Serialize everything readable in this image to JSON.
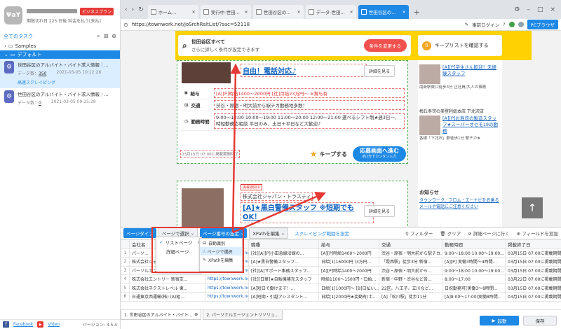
{
  "brand": {
    "logo": "ΨaY",
    "plan_badge": "ビジネスプラン",
    "expire": "期限切れ日 225 日後 料金を払う[支払]"
  },
  "tasks": {
    "header": "全てのタスク",
    "samples": "Samples",
    "default": "デフォルト",
    "items": [
      {
        "title": "世田谷区のアルバイト・バイト求人情報｜...",
        "data_label": "データ数：",
        "count": "350",
        "date": "2021-03-05 10:12:28",
        "cloud": "高速スクレイピング"
      },
      {
        "title": "世田谷区のアルバイト・バイト求人情報｜...",
        "data_label": "データ数：",
        "count": "0",
        "date": "2021-03-05 09:15:28",
        "cloud": ""
      }
    ]
  },
  "left_footer": {
    "facebook": "Facebook",
    "video": "Video",
    "version": "バージョン: 3.5.4"
  },
  "browser": {
    "tabs": [
      "ホーム...",
      "実行中-世田...",
      "世田谷区の...",
      "データ-世田...",
      "世田谷区の..."
    ],
    "url": "https://townwork.net/joSrchRsltList/?sac=52118",
    "login": "事前ログイン",
    "pc_browser": "PCブラウザ"
  },
  "page": {
    "search_title": "世田谷区すべて",
    "search_sub": "さらに詳しく条件が設定できます",
    "change_btn": "条件を変更する",
    "keep_count": "0",
    "keep_list": "キープリストを確認する",
    "job1_title": "自由！電話対応♪",
    "detail_btn": "詳細を見る",
    "salary_k": "給与",
    "salary_v": "[A][P]時給1400～2000円 [社]月給23万円～ ※賞与有",
    "transport_k": "交通",
    "transport_v": "渋谷・原宿・明大前から駅チカ勤務地多数！",
    "hours_k": "勤務時間",
    "hours_v": "9:00～18:00 10:00～19:00 11:00～20:00 12:00～21:00 選べるシフト制★週3日～、時短勤務応相談 平日のみ、土日＋平日など大歓迎♪",
    "date_small": "03月15日 07:00に掲載期間終了",
    "keep_btn": "キープする",
    "apply_btn": "応募画面へ進む",
    "apply_sub": "約1分でカンタン入力",
    "job2_badge": "掲載期間中",
    "job2_company": "株式会社ジャパン・トラスティ",
    "job2_title": "[A]★黒白警備スタッフ ※短期でもOK！",
    "side": [
      {
        "head": "",
        "title": "[A][P]学生さん歓迎！未経験スタッフ",
        "sub": "南新駅東口徒歩3分 正社員/大人の事務"
      },
      {
        "head": "梅丘寿司の美登利総本店 下北沢店",
        "title": "[A][P]お寿司の製造スタッフ★スーパーオセモ19の勤務",
        "sub": "各線「下北沢」駅徒歩1分 駅チカ★"
      }
    ],
    "notice_h": "お知らせ",
    "notice_b": "タウンワーク、フロム・エーナビを名乗るメールや電話にご注意ください"
  },
  "toolbar": {
    "page_type": "ページタイプ",
    "page_select": "ページで選択",
    "page_no": "ページ番号の設定",
    "xpath": "XPathを編集",
    "scrape_range": "スクレイピング範囲を設定",
    "filter": "フィルター",
    "clear": "クリア",
    "detail_page": "詳細ページに行く",
    "add_field": "フィールドを追加"
  },
  "dropdown": [
    "リストページ",
    "詳細ページ"
  ],
  "submenu": [
    "自動識別",
    "ページで選択",
    "XPathを編集"
  ],
  "grid": {
    "columns": [
      "会社名",
      "",
      "職種",
      "給与",
      "交通",
      "勤務時間",
      "掲載終了日"
    ],
    "rows": [
      [
        "パーソ...",
        "https://townwork.net/detail/cl...",
        "[社][A][P]小田急線沿線の...",
        "[A][P]時給1400～2000円",
        "渋谷・原宿・明大前から駅チカ...",
        "9:00～18:00 10:00～19:00...",
        "03月15日 07:00に掲載期間終"
      ],
      [
        "株式会社ジャパン・トラスティ",
        "https://townwork.net/detail/cl...",
        "[A]★黒白警備スタッフ...",
        "日給[1]16000円 (3万円...",
        "「霞西駅」徒歩3分 新宿...",
        "[A][P] 実働3時間～4時間...",
        "03月15日 07:00に掲載期間終"
      ],
      [
        "パーソルエンジニアリング",
        "https://townwork.net/detail/cl...",
        "[社][A]サポート事務スタッフ...",
        "[A][P]時給1400～2000円",
        "渋谷・原宿・明大前から...",
        "9:00～18:00 10:00～19:00...",
        "03月15日 07:00に掲載期間終"
      ],
      [
        "株式会社エントリー 新宿支...",
        "https://townwork.net/detail/cl...",
        "[社][日華]★自販機補充スタッフ",
        "時給1100～1500円・日給...",
        "新宿・中野・渋谷など各...",
        "8:00～17:00",
        "03月22日 07:00に掲載期間終"
      ],
      [
        "株式会社ネクストレベル 東...",
        "https://townwork.net/detail/cl...",
        "[A]短日で働けます！...",
        "日給[1]1000円～ [B]日払い...",
        "22区、八王子、立川など...",
        "日祝勤務可(実働3～8時間...",
        "03月15日 07:00に掲載期間終"
      ],
      [
        "日通東京西運輸(株) (A)組...",
        "https://townwork.net/detail/cl...",
        "[A]短期・引越アシスタント...",
        "日給[1]2000円★変動有(土...",
        "[A]「松川駅」徒歩11分",
        "[A]8:00～17:00(実働8時間...",
        "03月15日 07:00に掲載期間終"
      ]
    ]
  },
  "bottom": {
    "tabs": [
      "1. 世田谷区のアルバイト・バイト...",
      "2. パーソナルエージェントリソリュ..."
    ],
    "start": "起動",
    "save": "保存"
  }
}
